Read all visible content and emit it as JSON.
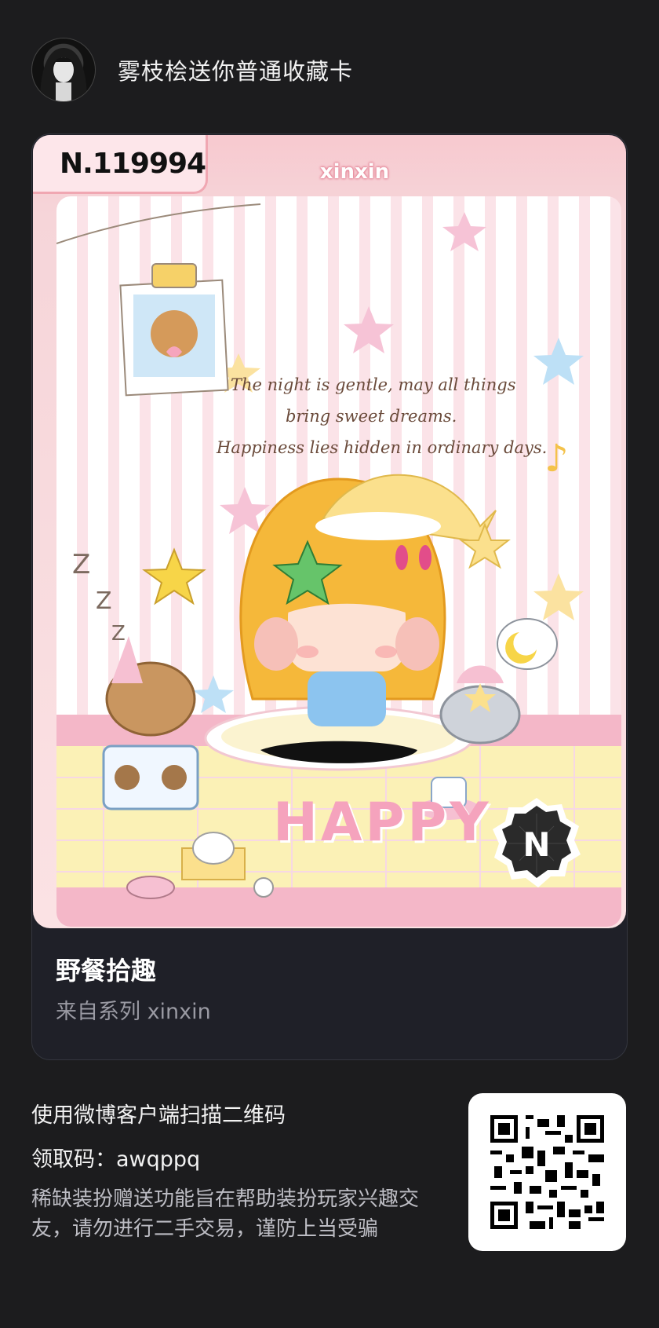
{
  "header": {
    "title": "雾枝桧送你普通收藏卡"
  },
  "card": {
    "serial": "N.119994",
    "series_tag": "xinxin",
    "quote_lines": [
      "The night is gentle, may all things",
      "bring sweet dreams.",
      "Happiness lies hidden in ordinary days."
    ],
    "happy_text": "HAPPY",
    "badge_letter": "N",
    "name": "野餐拾趣",
    "series_line": "来自系列 xinxin"
  },
  "footer": {
    "instruction": "使用微博客户端扫描二维码",
    "code_line": "领取码：awqppq",
    "note": "稀缺装扮赠送功能旨在帮助装扮玩家兴趣交友，请勿进行二手交易，谨防上当受骗"
  },
  "colors": {
    "background": "#1c1c1e",
    "panel": "#1f2028",
    "card_pink": "#f7c9cf",
    "hair_yellow": "#f5b83a",
    "accent_pink": "#f5a3bd"
  },
  "icons": [
    "avatar",
    "qr-code-icon",
    "badge-n-icon"
  ]
}
